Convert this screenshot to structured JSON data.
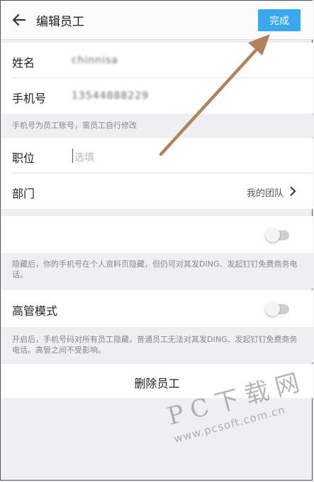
{
  "header": {
    "title": "编辑员工",
    "done_label": "完成"
  },
  "form": {
    "name": {
      "label": "姓名",
      "value": "chinnisa"
    },
    "phone": {
      "label": "手机号",
      "value": "13544888229"
    },
    "phone_hint": "手机号为员工账号，需员工自行修改",
    "position": {
      "label": "职位",
      "placeholder": "选填"
    },
    "department": {
      "label": "部门",
      "value": "我的团队"
    }
  },
  "privacy": {
    "hint": "隐藏后，你的手机号在个人资料页隐藏，但仍可对其发DING、发起钉钉免费商务电话。"
  },
  "executive": {
    "label": "高管模式",
    "hint": "开启后，手机号码对所有员工隐藏。普通员工无法对其发DING、发起钉钉免费商务电话。高管之间不受影响。"
  },
  "delete_label": "删除员工",
  "watermark": {
    "main": "PC下载网",
    "sub": "www.pcsoft.com.cn"
  },
  "colors": {
    "accent": "#3aa8ee",
    "annotation_arrow": "#b3825a"
  },
  "toggles": {
    "privacy_on": false,
    "executive_on": false
  }
}
